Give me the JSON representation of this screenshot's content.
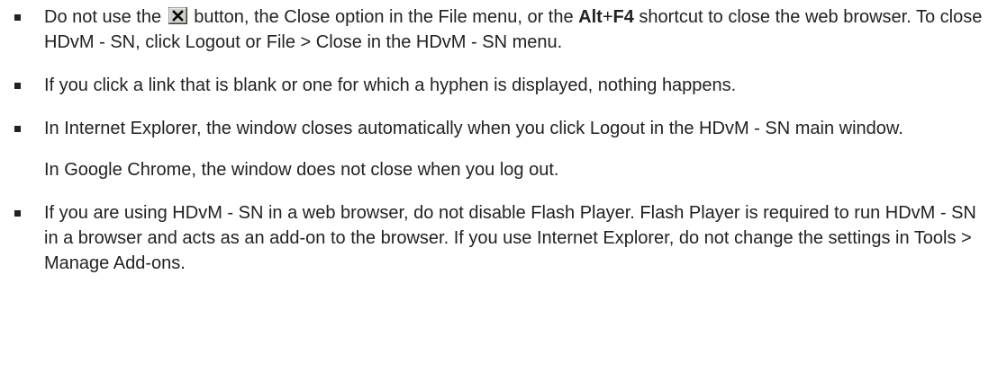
{
  "notes": [
    {
      "part1": "Do not use the",
      "part2": "button, the Close option in the File menu, or the",
      "key1": "Alt",
      "plus": "+",
      "key2": "F4",
      "part3": "shortcut to close the web browser. To close HDvM - SN, click Logout or File > Close in the HDvM - SN menu."
    },
    {
      "text": "If you click a link that is blank or one for which a hyphen is displayed, nothing happens."
    },
    {
      "text": "In Internet Explorer, the window closes automatically when you click Logout in the HDvM - SN main window.",
      "text2": "In Google Chrome, the window does not close when you log out."
    },
    {
      "text": "If you are using HDvM - SN in a web browser, do not disable Flash Player. Flash Player is required to run HDvM - SN in a browser and acts as an add-on to the browser. If you use Internet Explorer, do not change the settings in Tools > Manage Add-ons."
    }
  ],
  "icons": {
    "close_button": "close-x-button-icon"
  }
}
